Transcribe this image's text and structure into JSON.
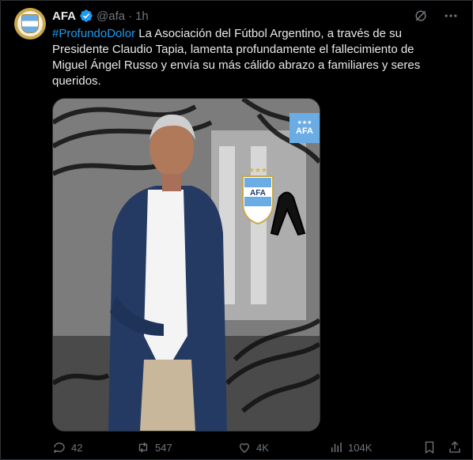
{
  "post": {
    "author_name": "AFA",
    "handle": "@afa",
    "separator": "·",
    "time": "1h",
    "hashtag": "#ProfundoDolor",
    "body": " La Asociación del Fútbol Argentino, a través de su Presidente Claudio Tapia, lamenta profundamente el fallecimiento de Miguel Ángel Russo y envía su más cálido abrazo a familiares y seres queridos."
  },
  "media": {
    "badge_text": "AFA",
    "badge_stars": "★★★",
    "crest_text": "AFA"
  },
  "actions": {
    "replies": "42",
    "reposts": "547",
    "likes": "4K",
    "views": "104K"
  },
  "icons": {
    "grok": "grok-icon",
    "more": "more-icon",
    "reply": "reply-icon",
    "repost": "repost-icon",
    "like": "heart-icon",
    "views": "views-icon",
    "bookmark": "bookmark-icon",
    "share": "share-icon"
  },
  "colors": {
    "background": "#000000",
    "text": "#e7e9ea",
    "muted": "#71767b",
    "link": "#1d9bf0",
    "verified": "#1d9bf0",
    "afa_blue": "#6cace4"
  }
}
